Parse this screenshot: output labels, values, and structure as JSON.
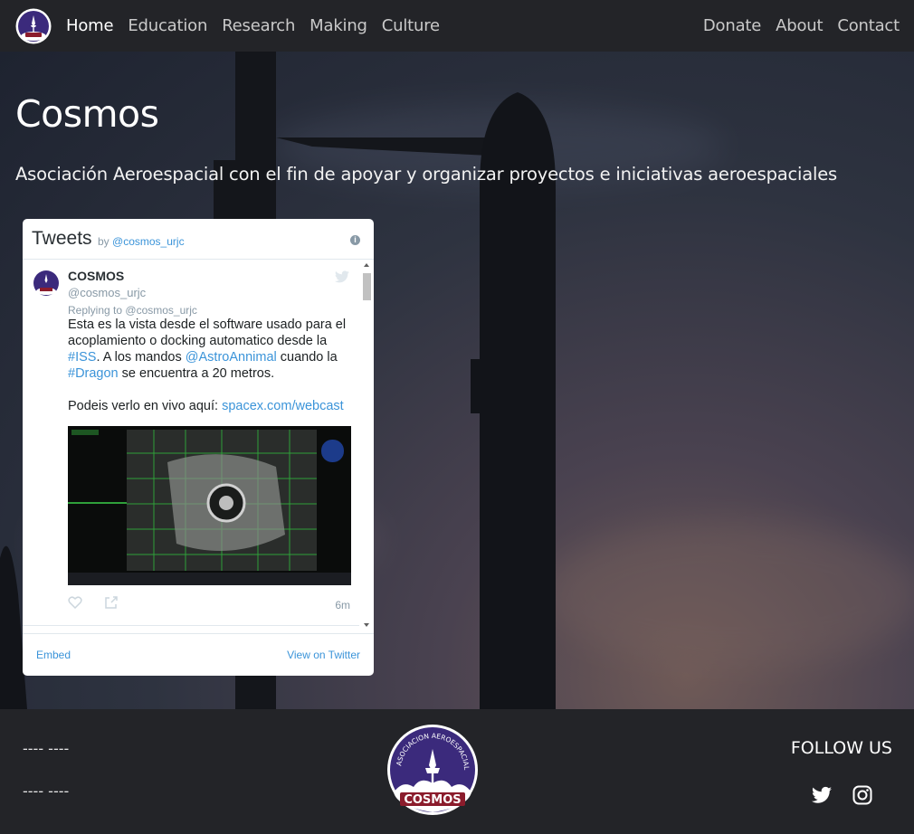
{
  "nav": {
    "logo_text": "COSMOS",
    "left": [
      {
        "label": "Home",
        "active": true
      },
      {
        "label": "Education"
      },
      {
        "label": "Research"
      },
      {
        "label": "Making"
      },
      {
        "label": "Culture"
      }
    ],
    "right": [
      {
        "label": "Donate"
      },
      {
        "label": "About"
      },
      {
        "label": "Contact"
      }
    ]
  },
  "hero": {
    "title": "Cosmos",
    "subtitle": "Asociación Aeroespacial con el fin de apoyar y organizar proyectos e iniciativas aeroespaciales"
  },
  "tweets_widget": {
    "title": "Tweets",
    "by_prefix": "by",
    "by_handle": "@cosmos_urjc",
    "tweet": {
      "name": "COSMOS",
      "handle": "@cosmos_urjc",
      "replying_prefix": "Replying to",
      "replying_handle": "@cosmos_urjc",
      "text_1": "Esta es la vista desde el software usado para el acoplamiento o docking automatico desde la",
      "tag_iss": "#ISS",
      "text_2": ". A los mandos",
      "mention": "@AstroAnnimal",
      "text_3": "cuando la",
      "tag_dragon": "#Dragon",
      "text_4": "se encuentra a 20 metros.",
      "text_5": "Podeis verlo en vivo aquí:",
      "link": "spacex.com/webcast",
      "time": "6m"
    },
    "embed_label": "Embed",
    "view_label": "View on Twitter"
  },
  "footer": {
    "line_1": "---- ----",
    "line_2": "---- ----",
    "logo_arc": "ASOCIACION AEROESPACIAL",
    "logo_text": "COSMOS",
    "follow_label": "FOLLOW US",
    "social": [
      "twitter-icon",
      "instagram-icon"
    ]
  },
  "colors": {
    "nav_bg": "#232428",
    "logo_purple": "#3b2a7c",
    "logo_red": "#8b1c2c",
    "link_blue": "#3b94d9"
  }
}
